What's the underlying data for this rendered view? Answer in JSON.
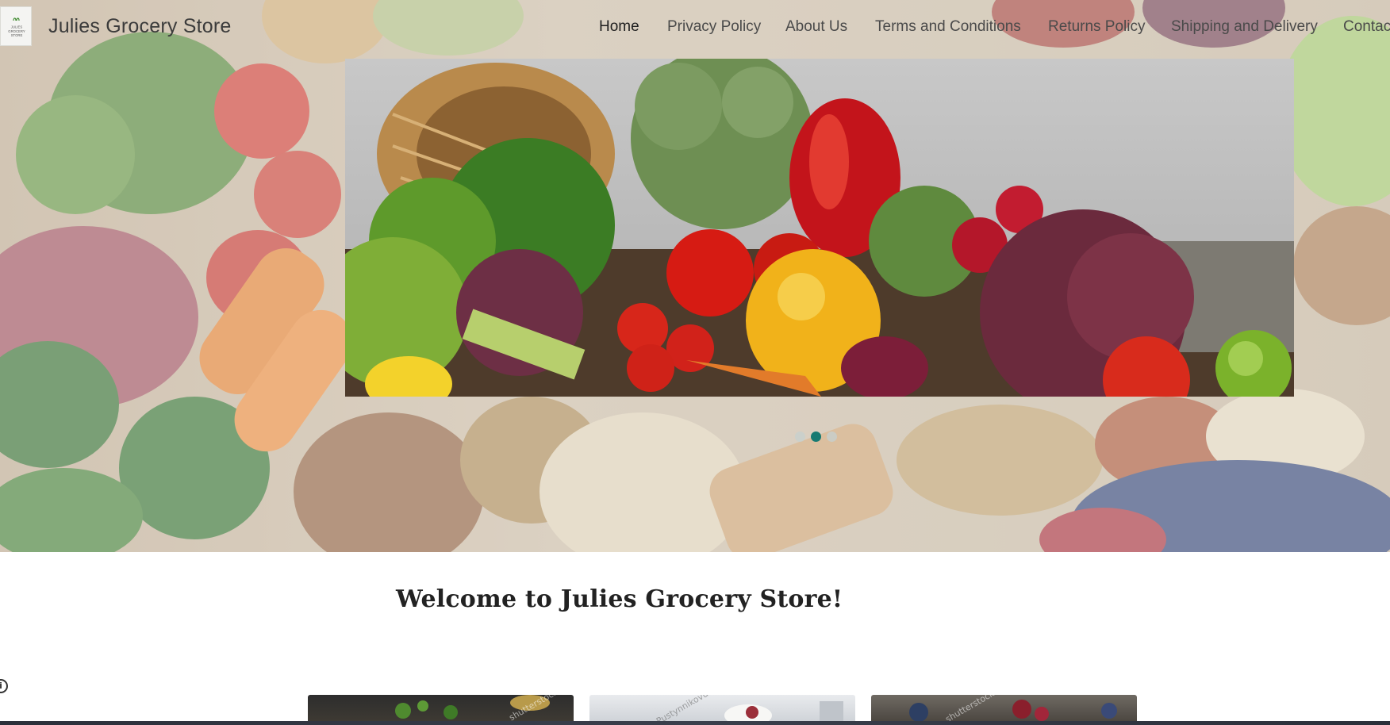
{
  "header": {
    "logo_text": "JULIES GROCERY STORE",
    "site_title": "Julies Grocery Store"
  },
  "nav": {
    "items": [
      {
        "label": "Home",
        "active": true
      },
      {
        "label": "Privacy Policy",
        "active": false
      },
      {
        "label": "About Us",
        "active": false
      },
      {
        "label": "Terms and Conditions",
        "active": false
      },
      {
        "label": "Returns Policy",
        "active": false
      },
      {
        "label": "Shipping and Delivery",
        "active": false
      },
      {
        "label": "Contact",
        "active": false
      }
    ]
  },
  "carousel": {
    "slide_count": 3,
    "active_index": 1
  },
  "main": {
    "welcome_heading": "Welcome to Julies Grocery Store!",
    "info_icon": "info-icon",
    "thumbnails": [
      {
        "watermark": "shutterstock"
      },
      {
        "watermark": "Pustynnikovus"
      },
      {
        "watermark": "shutterstock"
      }
    ]
  },
  "colors": {
    "accent": "#167a72",
    "dot_inactive": "#c7cfcd",
    "title_text": "#3b3b3b",
    "heading_text": "#222222"
  }
}
